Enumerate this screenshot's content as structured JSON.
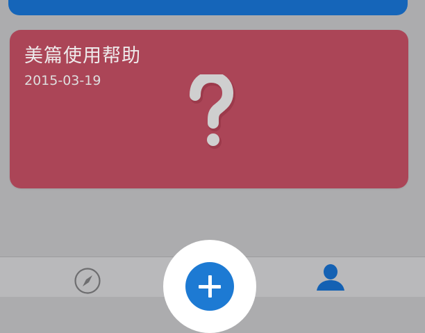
{
  "colors": {
    "background": "#acacae",
    "top_card": "#1565b9",
    "article_card": "#ab4557",
    "tab_bar": "#b9b9bb",
    "accent_blue": "#1d7ad3",
    "profile_blue": "#1461b3"
  },
  "top_card": {},
  "article": {
    "title": "美篇使用帮助",
    "date": "2015-03-19",
    "icon": "question-mark-icon"
  },
  "tab_bar": {
    "items": [
      {
        "icon": "compass-icon"
      },
      {
        "icon": "plus-icon"
      },
      {
        "icon": "person-icon"
      }
    ]
  }
}
